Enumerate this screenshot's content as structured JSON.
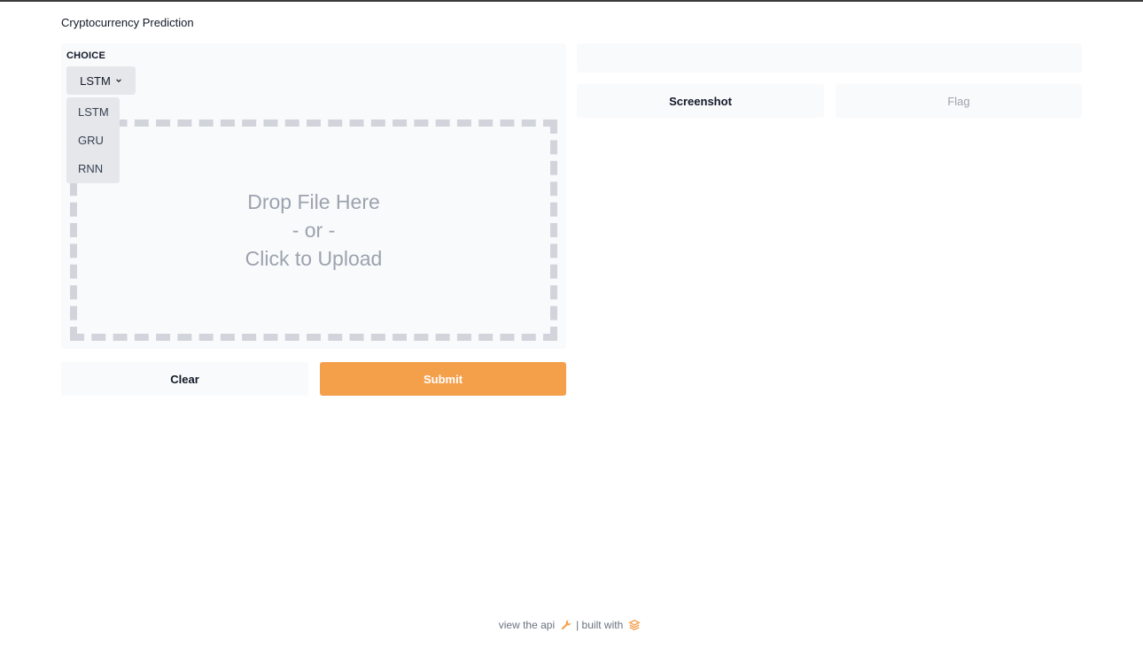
{
  "app": {
    "title": "Cryptocurrency Prediction"
  },
  "input": {
    "choice_label": "CHOICE",
    "selected": "LSTM",
    "options": [
      "LSTM",
      "GRU",
      "RNN"
    ],
    "dropzone": {
      "line1": "Drop File Here",
      "line2": "- or -",
      "line3": "Click to Upload"
    }
  },
  "actions": {
    "clear": "Clear",
    "submit": "Submit"
  },
  "output": {
    "screenshot": "Screenshot",
    "flag": "Flag"
  },
  "footer": {
    "api_text": "view the api",
    "built_text": "| built with"
  },
  "colors": {
    "accent": "#f4a04b",
    "panel": "#f9fafb",
    "dropdown": "#e5e7eb"
  },
  "icons": {
    "api": "wrench-icon",
    "brand": "gradio-logo-icon"
  }
}
